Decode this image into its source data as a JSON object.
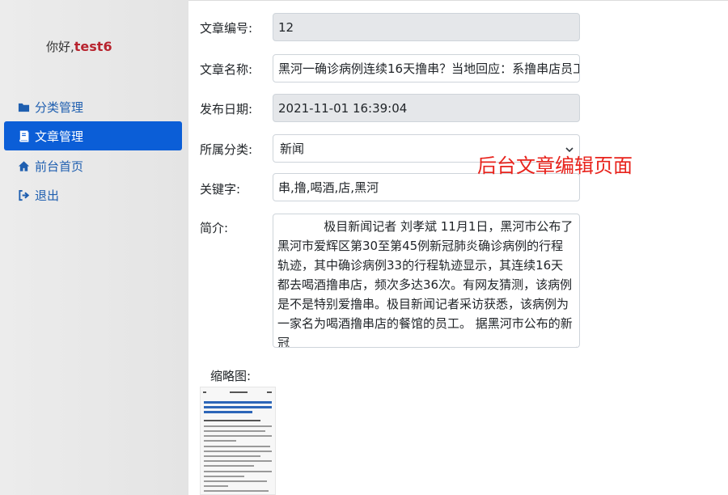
{
  "sidebar": {
    "greeting_prefix": "你好,",
    "username": "test6",
    "items": [
      {
        "label": "分类管理",
        "icon": "folder-icon",
        "active": false
      },
      {
        "label": "文章管理",
        "icon": "book-icon",
        "active": true
      },
      {
        "label": "前台首页",
        "icon": "home-icon",
        "active": false
      },
      {
        "label": "退出",
        "icon": "sign-out-icon",
        "active": false
      }
    ]
  },
  "form": {
    "id_label": "文章编号:",
    "id_value": "12",
    "title_label": "文章名称:",
    "title_value": "黑河一确诊病例连续16天撸串？当地回应：系撸串店员工",
    "date_label": "发布日期:",
    "date_value": "2021-11-01 16:39:04",
    "category_label": "所属分类:",
    "category_value": "新闻",
    "keywords_label": "关键字:",
    "keywords_value": "串,撸,喝酒,店,黑河",
    "summary_label": "简介:",
    "summary_value": "            极目新闻记者 刘孝斌 11月1日，黑河市公布了黑河市爱辉区第30至第45例新冠肺炎确诊病例的行程轨迹，其中确诊病例33的行程轨迹显示，其连续16天都去喝酒撸串店，频次多达36次。有网友猜测，该病例是不是特别爱撸串。极目新闻记者采访获悉，该病例为一家名为喝酒撸串店的餐馆的员工。 据黑河市公布的新冠",
    "thumbnail_label": "缩略图:"
  },
  "annotation": "后台文章编辑页面",
  "colors": {
    "accent": "#0b5ed7",
    "link": "#1f5fb0",
    "username": "#b8242f",
    "annotation": "#e8231c",
    "readonly_bg": "#e5e7ea"
  }
}
